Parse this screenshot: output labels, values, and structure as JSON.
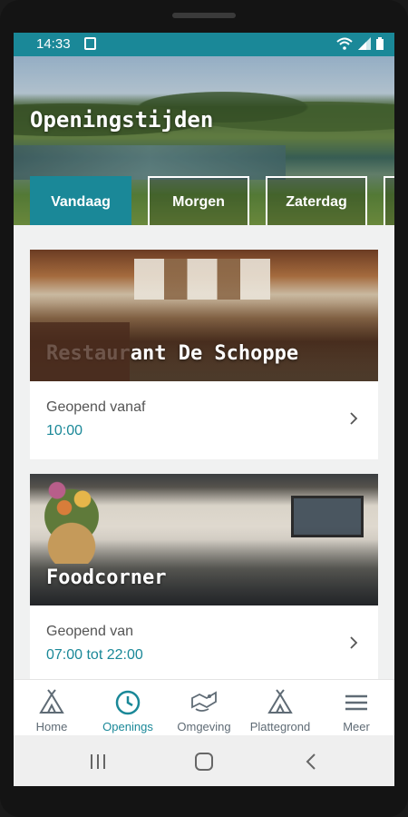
{
  "status": {
    "time": "14:33"
  },
  "header": {
    "title": "Openingstijden"
  },
  "day_tabs": [
    {
      "label": "Vandaag",
      "active": true
    },
    {
      "label": "Morgen",
      "active": false
    },
    {
      "label": "Zaterdag",
      "active": false
    }
  ],
  "cards": [
    {
      "title": "Restaurant De Schoppe",
      "label": "Geopend vanaf",
      "time": "10:00"
    },
    {
      "title": "Foodcorner",
      "label": "Geopend van",
      "time": "07:00 tot 22:00"
    }
  ],
  "nav": [
    {
      "label": "Home",
      "icon": "tent-icon",
      "active": false
    },
    {
      "label": "Openings",
      "icon": "clock-icon",
      "active": true
    },
    {
      "label": "Omgeving",
      "icon": "map-route-icon",
      "active": false
    },
    {
      "label": "Plattegrond",
      "icon": "tent-icon",
      "active": false
    },
    {
      "label": "Meer",
      "icon": "menu-icon",
      "active": false
    }
  ],
  "colors": {
    "accent": "#1a8898",
    "nav_text": "#5f6b75"
  }
}
